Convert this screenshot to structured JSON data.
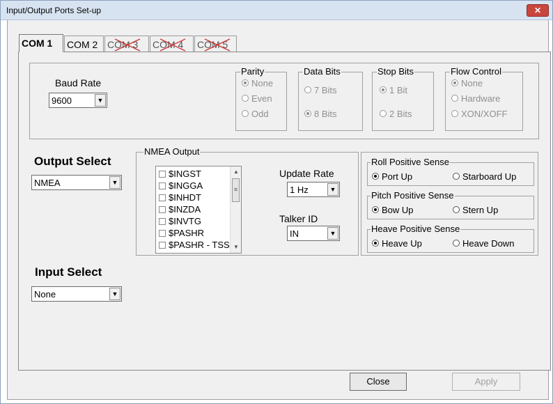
{
  "window": {
    "title": "Input/Output Ports Set-up",
    "close_icon": "close-icon"
  },
  "tabs": [
    {
      "label": "COM 1",
      "state": "active"
    },
    {
      "label": "COM 2",
      "state": "enabled"
    },
    {
      "label": "COM 3",
      "state": "crossed-out"
    },
    {
      "label": "COM 4",
      "state": "crossed-out"
    },
    {
      "label": "COM 5",
      "state": "crossed-out"
    }
  ],
  "serial": {
    "baud_label": "Baud Rate",
    "baud_value": "9600",
    "parity": {
      "label": "Parity",
      "options": [
        "None",
        "Even",
        "Odd"
      ],
      "selected": "None"
    },
    "data_bits": {
      "label": "Data Bits",
      "options": [
        "7 Bits",
        "8 Bits"
      ],
      "selected": "8 Bits"
    },
    "stop_bits": {
      "label": "Stop Bits",
      "options": [
        "1 Bit",
        "2 Bits"
      ],
      "selected": "1 Bit"
    },
    "flow_control": {
      "label": "Flow Control",
      "options": [
        "None",
        "Hardware",
        "XON/XOFF"
      ],
      "selected": "None"
    }
  },
  "output_select": {
    "label": "Output Select",
    "value": "NMEA"
  },
  "nmea_output": {
    "label": "NMEA Output",
    "items": [
      "$INGST",
      "$INGGA",
      "$INHDT",
      "$INZDA",
      "$INVTG",
      "$PASHR",
      "$PASHR - TSS"
    ]
  },
  "update_rate": {
    "label": "Update Rate",
    "value": "1 Hz"
  },
  "talker_id": {
    "label": "Talker ID",
    "value": "IN"
  },
  "roll": {
    "label": "Roll Positive Sense",
    "options": [
      "Port Up",
      "Starboard Up"
    ],
    "selected": "Port Up"
  },
  "pitch": {
    "label": "Pitch Positive Sense",
    "options": [
      "Bow Up",
      "Stern Up"
    ],
    "selected": "Bow Up"
  },
  "heave": {
    "label": "Heave Positive Sense",
    "options": [
      "Heave Up",
      "Heave Down"
    ],
    "selected": "Heave Up"
  },
  "input_select": {
    "label": "Input Select",
    "value": "None"
  },
  "buttons": {
    "close": "Close",
    "apply": "Apply"
  }
}
